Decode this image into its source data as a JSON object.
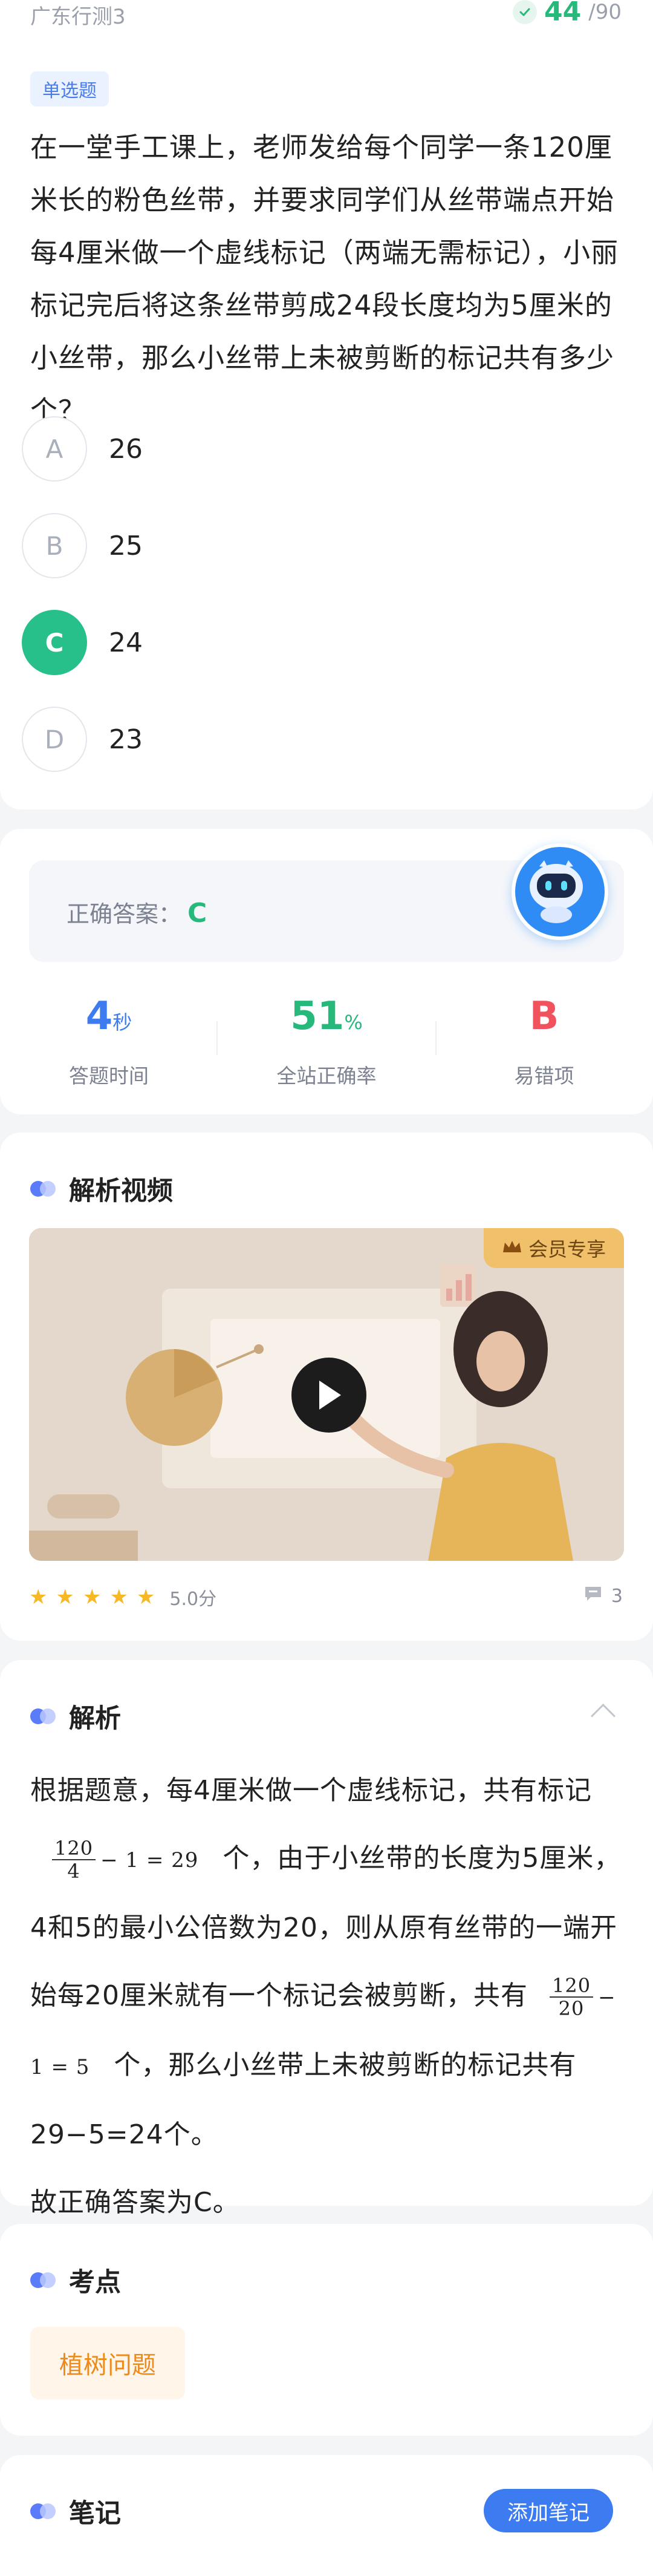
{
  "header": {
    "subject": "广东行测3",
    "progress_current": "44",
    "progress_total": "/90"
  },
  "question": {
    "type": "单选题",
    "text": "在一堂手工课上，老师发给每个同学一条120厘米长的粉色丝带，并要求同学们从丝带端点开始每4厘米做一个虚线标记（两端无需标记），小丽标记完后将这条丝带剪成24段长度均为5厘米的小丝带，那么小丝带上未被剪断的标记共有多少个？",
    "options": [
      {
        "letter": "A",
        "text": "26"
      },
      {
        "letter": "B",
        "text": "25"
      },
      {
        "letter": "C",
        "text": "24"
      },
      {
        "letter": "D",
        "text": "23"
      }
    ],
    "selected": "C"
  },
  "answer": {
    "label": "正确答案：",
    "value": "C",
    "stats": [
      {
        "value": "4",
        "unit": "秒",
        "label": "答题时间",
        "color": "#3d7bf0"
      },
      {
        "value": "51",
        "unit": "%",
        "label": "全站正确率",
        "color": "#27b97b"
      },
      {
        "value": "B",
        "unit": "",
        "label": "易错项",
        "color": "#f0525e"
      }
    ]
  },
  "video": {
    "title": "解析视频",
    "badge": "会员专享",
    "rating": "5.0分",
    "star_count": 5,
    "comments": "3"
  },
  "analysis": {
    "title": "解析",
    "p1": "根据题意，每4厘米做一个虚线标记，共有标记",
    "frac1_num": "120",
    "frac1_den": "4",
    "frac1_rest": "− 1 = 29",
    "p2": "个，由于小丝带的长度为5厘米，4和5的最小公倍数为20，则从原有丝带的一端开始每20厘米就有一个标记会被剪断，共有",
    "frac2_num": "120",
    "frac2_den": "20",
    "frac2_rest": "− 1 = 5",
    "p3": "个，那么小丝带上未被剪断的标记共有29−5=24个。",
    "p4": "故正确答案为C。"
  },
  "keypoint": {
    "title": "考点",
    "tag": "植树问题"
  },
  "notes": {
    "title": "笔记",
    "add_label": "添加笔记"
  }
}
